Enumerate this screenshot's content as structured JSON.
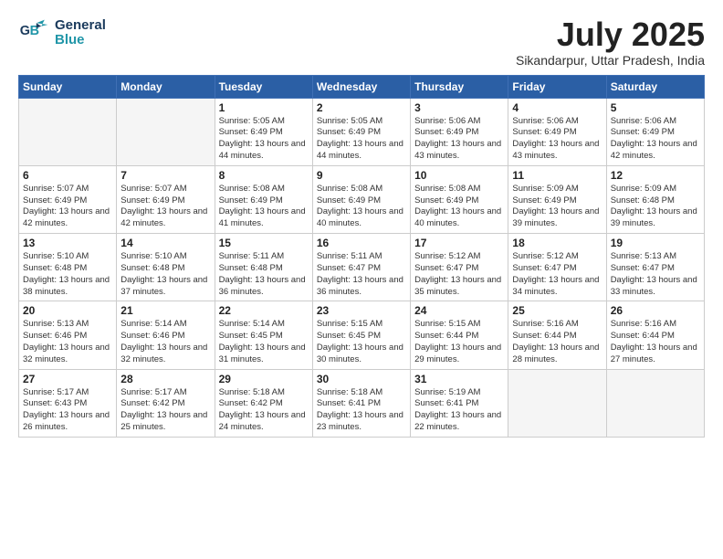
{
  "logo": {
    "line1": "General",
    "line2": "Blue"
  },
  "title": "July 2025",
  "location": "Sikandarpur, Uttar Pradesh, India",
  "weekdays": [
    "Sunday",
    "Monday",
    "Tuesday",
    "Wednesday",
    "Thursday",
    "Friday",
    "Saturday"
  ],
  "weeks": [
    [
      {
        "day": "",
        "info": ""
      },
      {
        "day": "",
        "info": ""
      },
      {
        "day": "1",
        "info": "Sunrise: 5:05 AM\nSunset: 6:49 PM\nDaylight: 13 hours and 44 minutes."
      },
      {
        "day": "2",
        "info": "Sunrise: 5:05 AM\nSunset: 6:49 PM\nDaylight: 13 hours and 44 minutes."
      },
      {
        "day": "3",
        "info": "Sunrise: 5:06 AM\nSunset: 6:49 PM\nDaylight: 13 hours and 43 minutes."
      },
      {
        "day": "4",
        "info": "Sunrise: 5:06 AM\nSunset: 6:49 PM\nDaylight: 13 hours and 43 minutes."
      },
      {
        "day": "5",
        "info": "Sunrise: 5:06 AM\nSunset: 6:49 PM\nDaylight: 13 hours and 42 minutes."
      }
    ],
    [
      {
        "day": "6",
        "info": "Sunrise: 5:07 AM\nSunset: 6:49 PM\nDaylight: 13 hours and 42 minutes."
      },
      {
        "day": "7",
        "info": "Sunrise: 5:07 AM\nSunset: 6:49 PM\nDaylight: 13 hours and 42 minutes."
      },
      {
        "day": "8",
        "info": "Sunrise: 5:08 AM\nSunset: 6:49 PM\nDaylight: 13 hours and 41 minutes."
      },
      {
        "day": "9",
        "info": "Sunrise: 5:08 AM\nSunset: 6:49 PM\nDaylight: 13 hours and 40 minutes."
      },
      {
        "day": "10",
        "info": "Sunrise: 5:08 AM\nSunset: 6:49 PM\nDaylight: 13 hours and 40 minutes."
      },
      {
        "day": "11",
        "info": "Sunrise: 5:09 AM\nSunset: 6:49 PM\nDaylight: 13 hours and 39 minutes."
      },
      {
        "day": "12",
        "info": "Sunrise: 5:09 AM\nSunset: 6:48 PM\nDaylight: 13 hours and 39 minutes."
      }
    ],
    [
      {
        "day": "13",
        "info": "Sunrise: 5:10 AM\nSunset: 6:48 PM\nDaylight: 13 hours and 38 minutes."
      },
      {
        "day": "14",
        "info": "Sunrise: 5:10 AM\nSunset: 6:48 PM\nDaylight: 13 hours and 37 minutes."
      },
      {
        "day": "15",
        "info": "Sunrise: 5:11 AM\nSunset: 6:48 PM\nDaylight: 13 hours and 36 minutes."
      },
      {
        "day": "16",
        "info": "Sunrise: 5:11 AM\nSunset: 6:47 PM\nDaylight: 13 hours and 36 minutes."
      },
      {
        "day": "17",
        "info": "Sunrise: 5:12 AM\nSunset: 6:47 PM\nDaylight: 13 hours and 35 minutes."
      },
      {
        "day": "18",
        "info": "Sunrise: 5:12 AM\nSunset: 6:47 PM\nDaylight: 13 hours and 34 minutes."
      },
      {
        "day": "19",
        "info": "Sunrise: 5:13 AM\nSunset: 6:47 PM\nDaylight: 13 hours and 33 minutes."
      }
    ],
    [
      {
        "day": "20",
        "info": "Sunrise: 5:13 AM\nSunset: 6:46 PM\nDaylight: 13 hours and 32 minutes."
      },
      {
        "day": "21",
        "info": "Sunrise: 5:14 AM\nSunset: 6:46 PM\nDaylight: 13 hours and 32 minutes."
      },
      {
        "day": "22",
        "info": "Sunrise: 5:14 AM\nSunset: 6:45 PM\nDaylight: 13 hours and 31 minutes."
      },
      {
        "day": "23",
        "info": "Sunrise: 5:15 AM\nSunset: 6:45 PM\nDaylight: 13 hours and 30 minutes."
      },
      {
        "day": "24",
        "info": "Sunrise: 5:15 AM\nSunset: 6:44 PM\nDaylight: 13 hours and 29 minutes."
      },
      {
        "day": "25",
        "info": "Sunrise: 5:16 AM\nSunset: 6:44 PM\nDaylight: 13 hours and 28 minutes."
      },
      {
        "day": "26",
        "info": "Sunrise: 5:16 AM\nSunset: 6:44 PM\nDaylight: 13 hours and 27 minutes."
      }
    ],
    [
      {
        "day": "27",
        "info": "Sunrise: 5:17 AM\nSunset: 6:43 PM\nDaylight: 13 hours and 26 minutes."
      },
      {
        "day": "28",
        "info": "Sunrise: 5:17 AM\nSunset: 6:42 PM\nDaylight: 13 hours and 25 minutes."
      },
      {
        "day": "29",
        "info": "Sunrise: 5:18 AM\nSunset: 6:42 PM\nDaylight: 13 hours and 24 minutes."
      },
      {
        "day": "30",
        "info": "Sunrise: 5:18 AM\nSunset: 6:41 PM\nDaylight: 13 hours and 23 minutes."
      },
      {
        "day": "31",
        "info": "Sunrise: 5:19 AM\nSunset: 6:41 PM\nDaylight: 13 hours and 22 minutes."
      },
      {
        "day": "",
        "info": ""
      },
      {
        "day": "",
        "info": ""
      }
    ]
  ]
}
